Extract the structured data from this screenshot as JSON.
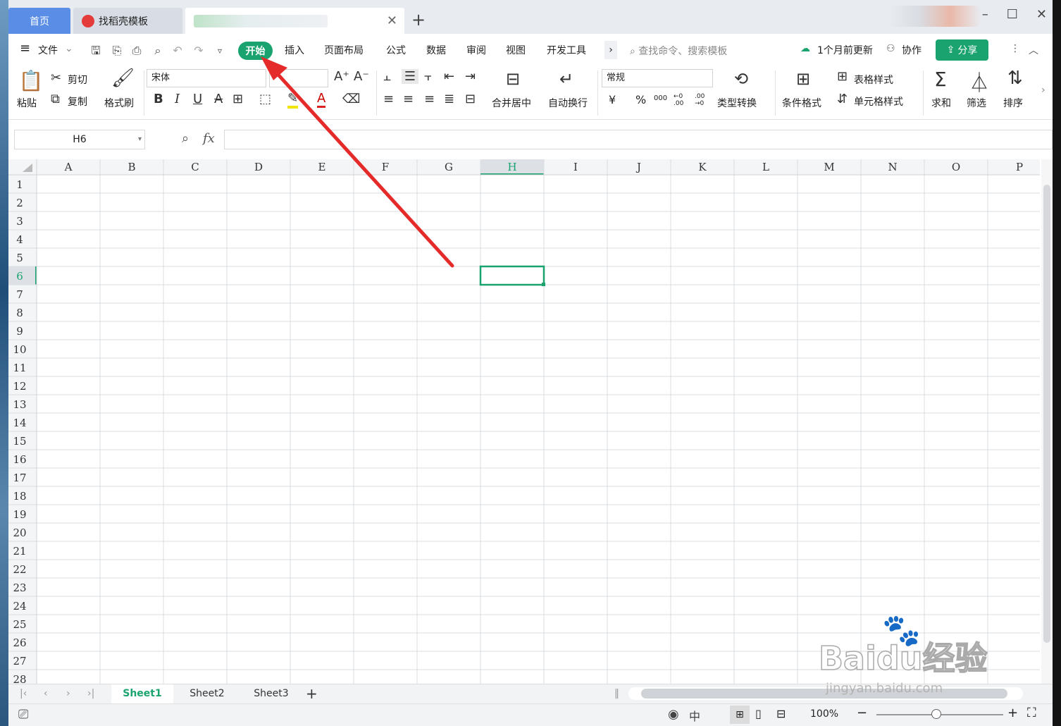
{
  "tabs": {
    "home": "首页",
    "template": "找稻壳模板",
    "add": "+"
  },
  "window_controls": {
    "minimize": "–",
    "maximize": "☐",
    "close": "✕"
  },
  "menu": {
    "file": "文件",
    "start": "开始",
    "items": [
      "插入",
      "页面布局",
      "公式",
      "数据",
      "审阅",
      "视图",
      "开发工具"
    ],
    "more": "›",
    "search_placeholder": "查找命令、搜索模板",
    "update": "1个月前更新",
    "collab": "协作",
    "share": "分享"
  },
  "ribbon": {
    "paste": "粘贴",
    "cut": "剪切",
    "copy": "复制",
    "format_painter": "格式刷",
    "font_name": "宋体",
    "merge": "合并居中",
    "wrap": "自动换行",
    "number_format": "常规",
    "convert": "类型转换",
    "cond_format": "条件格式",
    "table_style": "表格样式",
    "cell_style": "单元格样式",
    "sum": "求和",
    "filter": "筛选",
    "sort": "排序",
    "bold": "B",
    "italic": "I",
    "underline": "U",
    "strike": "A",
    "font_color": "A",
    "yen": "¥",
    "percent": "%",
    "thousands": "000",
    "dec_inc": "←0 .00",
    "dec_dec": ".00 →0"
  },
  "formula_bar": {
    "name_box": "H6",
    "fx": "fx"
  },
  "grid": {
    "columns": [
      "A",
      "B",
      "C",
      "D",
      "E",
      "F",
      "G",
      "H",
      "I",
      "J",
      "K",
      "L",
      "M",
      "N",
      "O",
      "P"
    ],
    "rows": [
      "1",
      "2",
      "3",
      "4",
      "5",
      "6",
      "7",
      "8",
      "9",
      "10",
      "11",
      "12",
      "13",
      "14",
      "15",
      "16",
      "17",
      "18",
      "19",
      "20",
      "21",
      "22",
      "23",
      "24",
      "25",
      "26",
      "27",
      "28"
    ],
    "selected_col": "H",
    "selected_row": "6",
    "accent": "#1aa36f"
  },
  "sheets": {
    "tabs": [
      "Sheet1",
      "Sheet2",
      "Sheet3"
    ],
    "active": "Sheet1",
    "add": "+"
  },
  "status": {
    "zoom": "100%"
  },
  "watermark": {
    "brand": "Baidu经验",
    "url": "jingyan.baidu.com"
  }
}
